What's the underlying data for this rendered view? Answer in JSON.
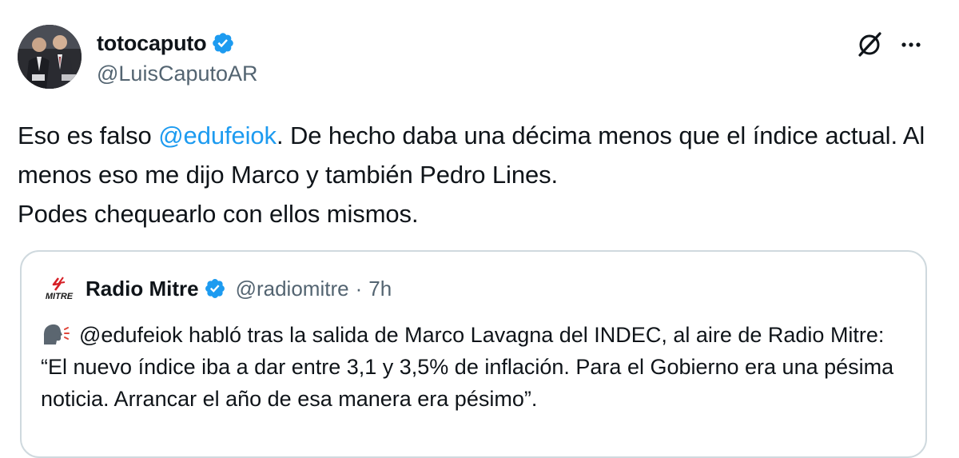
{
  "tweet": {
    "author": {
      "name": "totocaputo",
      "handle": "@LuisCaputoAR",
      "verified": true
    },
    "text": {
      "part1": "Eso es falso ",
      "mention": "@edufeiok",
      "part2": ". De hecho daba una décima menos que el índice actual. Al menos eso me dijo Marco y también Pedro Lines.",
      "part3": "Podes chequearlo con ellos mismos."
    },
    "icons": {
      "grok": "grok-icon",
      "more": "more-options-icon"
    }
  },
  "quote": {
    "author": {
      "name": "Radio Mitre",
      "handle": "@radiomitre",
      "separator": "·",
      "time": "7h",
      "logo_text": "MITRE"
    },
    "text": "@edufeiok habló tras la salida de Marco Lavagna del INDEC, al aire de Radio Mitre: “El nuevo índice iba a dar entre 3,1 y 3,5% de inflación. Para el Gobierno era una pésima noticia. Arrancar el año de esa manera era pésimo”.",
    "emoji": "speaking-head-icon"
  },
  "colors": {
    "text": "#0f1419",
    "secondary": "#536471",
    "link": "#1d9bf0",
    "verified": "#1d9bf0",
    "border": "#cfd9de",
    "mitre_red": "#d62027"
  }
}
